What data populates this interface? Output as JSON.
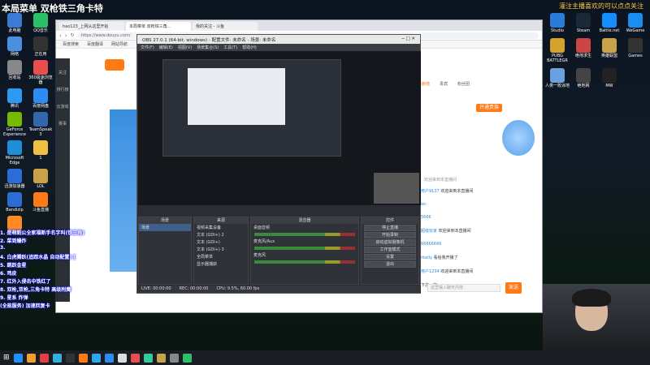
{
  "overlay": {
    "title": "本局菜单 双枪铁三角卡特",
    "notice": "灌注主播喜欢的可以点点关注",
    "lines": [
      "1. 是萌新公全家福新手名字叫(铁三角)",
      "2. 菜到爆炸",
      "3.",
      "4. 白虎腾跃(追踪水晶 自动配置) [",
      "5. 跳跃金星",
      "6. 鸡皮",
      "7. 红外入侵击中铁红了",
      "8. 双枪,双枪,三角卡特 高级附魔",
      "9. 星系 炸弹",
      "(全能服务) 加速回复卡"
    ]
  },
  "desktop_left": [
    {
      "label": "此电脑",
      "color": "#3a7bd5"
    },
    {
      "label": "QQ音乐",
      "color": "#2bbf6a"
    },
    {
      "label": "网络",
      "color": "#4a8fe0"
    },
    {
      "label": "正在用",
      "color": "#333"
    },
    {
      "label": "回收站",
      "color": "#888"
    },
    {
      "label": "360极速浏览器",
      "color": "#e94e4e"
    },
    {
      "label": "腾讯",
      "color": "#2b9af3"
    },
    {
      "label": "百度网盘",
      "color": "#2b8cf3"
    },
    {
      "label": "GeForce Experience",
      "color": "#76b900"
    },
    {
      "label": "TeamSpeak 3",
      "color": "#3366aa"
    },
    {
      "label": "Microsoft Edge",
      "color": "#1c8fd8"
    },
    {
      "label": "1",
      "color": "#f0c040"
    },
    {
      "label": "迅游加速器",
      "color": "#2a6dd6"
    },
    {
      "label": "LOL",
      "color": "#c8a24a"
    },
    {
      "label": "Bandizip",
      "color": "#2a6dd6"
    },
    {
      "label": "斗鱼直播",
      "color": "#ff7a14"
    },
    {
      "label": "石片截图",
      "color": "#ff8a24"
    }
  ],
  "desktop_right": [
    {
      "label": "Studio",
      "color": "#2b7bd8"
    },
    {
      "label": "Steam",
      "color": "#1b2838"
    },
    {
      "label": "Battle.net",
      "color": "#148eff"
    },
    {
      "label": "WeGame",
      "color": "#1a8ef0"
    },
    {
      "label": "PUBG BATTLEGR",
      "color": "#d4a22a"
    },
    {
      "label": "绝地求生",
      "color": "#c44"
    },
    {
      "label": "英雄联盟",
      "color": "#c8a24a"
    },
    {
      "label": "Games",
      "color": "#333"
    },
    {
      "label": "人类一败涂地",
      "color": "#6aa0e0"
    },
    {
      "label": "绝地网",
      "color": "#444"
    },
    {
      "label": "MW",
      "color": "#222"
    }
  ],
  "browser": {
    "tabs": [
      "hao123_上网从这里开始",
      "本局菜单 双枪铁三角...",
      "我的关注 - 斗鱼"
    ],
    "address": "https://www.douyu.com/",
    "bookmarks": [
      "百度搜索",
      "百度翻译",
      "网站导航"
    ]
  },
  "douyu": {
    "nav": [
      "关注",
      "排行榜",
      "云游戏",
      "赛事"
    ],
    "panel_tabs": [
      "贡献榜",
      "贵宾",
      "粉丝团"
    ],
    "open_noble_btn": "开通贵族",
    "welcome_notice": "欢迎来到本直播间",
    "chat": [
      {
        "user": "用户9137",
        "text": "欢迎来到本直播间"
      },
      {
        "user": "wc",
        "text": ""
      },
      {
        "user": "5666",
        "text": ""
      },
      {
        "user": "超级玩家",
        "text": "欢迎来到本直播间"
      },
      {
        "user": "66666666",
        "text": ""
      },
      {
        "user": "rbelly",
        "text": "看给我开播了"
      },
      {
        "user": "用户1234",
        "text": "欢迎来到本直播间"
      },
      {
        "user": "",
        "text": "下次一定"
      }
    ],
    "chat_placeholder": "这里输入聊天内容",
    "send_label": "发送"
  },
  "obs": {
    "title": "OBS 27.0.1 (64-bit, windows) - 配置文件: 未命名 - 场景: 未命名",
    "menu": [
      "文件(F)",
      "编辑(E)",
      "视图(V)",
      "场景集合(S)",
      "工具(T)",
      "帮助(H)"
    ],
    "panels": {
      "scenes": "场景",
      "sources": "来源",
      "mixer": "混音器",
      "transitions": "场景过渡",
      "controls": "控件"
    },
    "scene_items": [
      "场景"
    ],
    "source_items": [
      "视频采集设备",
      "文本 (GDI+) 2",
      "文本 (GDI+)",
      "文本 (GDI+) 3",
      "全局菜单",
      "显示器捕获"
    ],
    "mixer_items": [
      "桌面音频",
      "麦克风/Aux",
      "麦克风"
    ],
    "controls": [
      "停止直播",
      "开始录制",
      "启动虚拟摄像机",
      "工作室模式",
      "设置",
      "退出"
    ],
    "status": [
      "LIVE: 00:00:00",
      "REC: 00:00:00",
      "CPU: 9.5%, 60.00 fps"
    ]
  },
  "taskbar_colors": [
    "#1e90ff",
    "#f0a030",
    "#e04040",
    "#30b0e0",
    "#333",
    "#ff7a14",
    "#2aa8f0",
    "#2b8cf3",
    "#ddd",
    "#e94e4e",
    "#3c9",
    "#c8a24a",
    "#888",
    "#2bbf6a"
  ]
}
